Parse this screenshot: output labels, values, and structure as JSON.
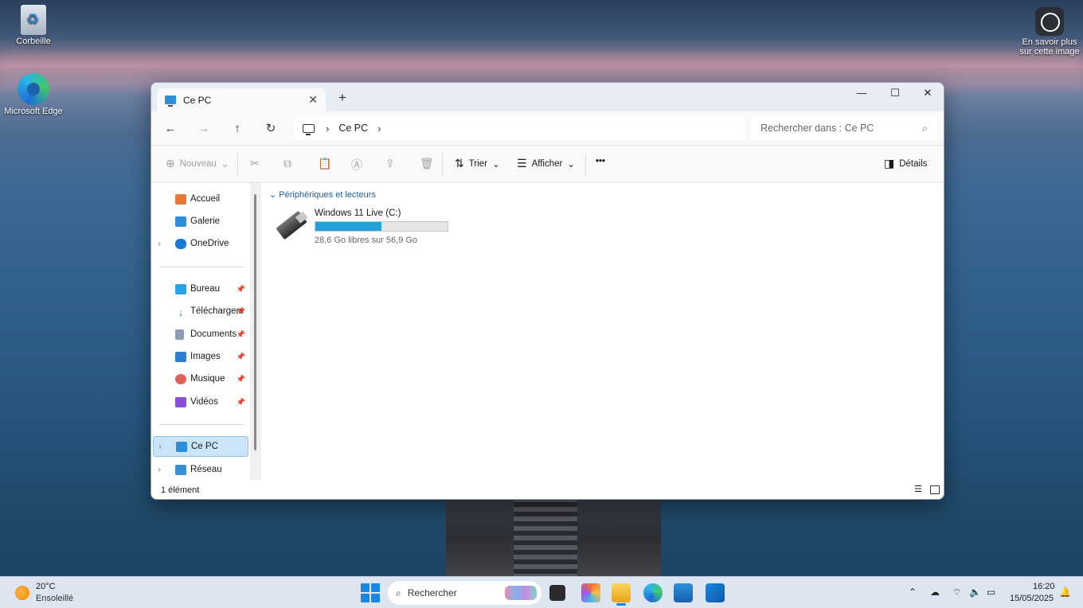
{
  "desktop": {
    "icons": [
      {
        "label": "Corbeille"
      },
      {
        "label": "Microsoft Edge"
      },
      {
        "label": "En savoir plus sur cette image"
      }
    ]
  },
  "window": {
    "tab_title": "Ce PC",
    "new_tab": "+",
    "controls": {
      "minimize": "—",
      "maximize": "☐",
      "close": "✕"
    },
    "nav": {
      "back": "←",
      "forward": "→",
      "up": "↑",
      "refresh": "↻"
    },
    "breadcrumb": [
      "Ce PC"
    ],
    "search_placeholder": "Rechercher dans : Ce PC",
    "toolbar": {
      "new_label": "Nouveau",
      "sort_label": "Trier",
      "view_label": "Afficher",
      "more": "•••",
      "details_label": "Détails"
    },
    "sidebar": {
      "top": [
        {
          "label": "Accueil",
          "icon": "home-icon",
          "color": "#e8783a"
        },
        {
          "label": "Galerie",
          "icon": "gallery-icon",
          "color": "#2f8fdb"
        },
        {
          "label": "OneDrive",
          "icon": "cloud-icon",
          "color": "#1a78d4"
        }
      ],
      "pinned": [
        {
          "label": "Bureau",
          "icon": "desktop-folder-icon",
          "color": "#2aa0e6"
        },
        {
          "label": "Téléchargem",
          "icon": "download-icon",
          "color": "#1e9e6a"
        },
        {
          "label": "Documents",
          "icon": "documents-icon",
          "color": "#8c9bb0"
        },
        {
          "label": "Images",
          "icon": "images-icon",
          "color": "#2f7fd0"
        },
        {
          "label": "Musique",
          "icon": "music-icon",
          "color": "#e0605a"
        },
        {
          "label": "Vidéos",
          "icon": "videos-icon",
          "color": "#8b4ed8"
        }
      ],
      "bottom": [
        {
          "label": "Ce PC",
          "icon": "pc-icon",
          "color": "#2f8fdb"
        },
        {
          "label": "Réseau",
          "icon": "network-icon",
          "color": "#3a8fd0"
        }
      ]
    },
    "content": {
      "group_header": "Périphériques et lecteurs",
      "drive": {
        "name": "Windows 11 Live (C:)",
        "free_text": "28,6 Go libres sur 56,9 Go",
        "used_fraction": 0.497
      }
    },
    "status": "1 élément"
  },
  "taskbar": {
    "weather_temp": "20°C",
    "weather_desc": "Ensoleillé",
    "search_label": "Rechercher",
    "time": "16:20",
    "date": "15/05/2025"
  }
}
